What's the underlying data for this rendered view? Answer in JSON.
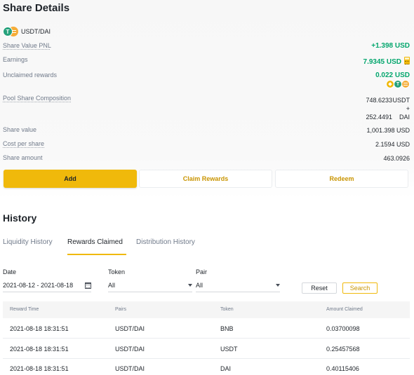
{
  "share_details": {
    "title": "Share Details",
    "pair": "USDT/DAI",
    "rows": {
      "share_value_pnl": {
        "label": "Share Value PNL",
        "value": "+1.398 USD"
      },
      "earnings": {
        "label": "Earnings",
        "value": "7.9345 USD"
      },
      "unclaimed": {
        "label": "Unclaimed rewards",
        "value": "0.022 USD"
      },
      "composition": {
        "label": "Pool Share Composition",
        "amount1": "748.6233",
        "unit1": "USDT",
        "plus": "+",
        "amount2": "252.4491",
        "unit2": "DAI"
      },
      "share_value": {
        "label": "Share value",
        "value": "1,001.398 USD"
      },
      "cost_per_share": {
        "label": "Cost per share",
        "value": "2.1594 USD"
      },
      "share_amount": {
        "label": "Share amount",
        "value": "463.0926"
      }
    },
    "buttons": {
      "add": "Add",
      "claim": "Claim Rewards",
      "redeem": "Redeem"
    },
    "reward_icons": [
      "bnb-icon",
      "usdt-icon",
      "dai-icon"
    ],
    "colors": {
      "accent": "#f0b90b",
      "positive": "#03a66d",
      "link": "#c99400"
    }
  },
  "history": {
    "title": "History",
    "tabs": [
      "Liquidity History",
      "Rewards Claimed",
      "Distribution History"
    ],
    "active_tab": "Rewards Claimed",
    "filters": {
      "date_label": "Date",
      "date_value": "2021-08-12 - 2021-08-18",
      "token_label": "Token",
      "token_value": "All",
      "pair_label": "Pair",
      "pair_value": "All",
      "reset": "Reset",
      "search": "Search"
    },
    "table": {
      "headers": [
        "Reward Time",
        "Pairs",
        "Token",
        "Amount Claimed"
      ],
      "rows": [
        [
          "2021-08-18 18:31:51",
          "USDT/DAI",
          "BNB",
          "0.03700098"
        ],
        [
          "2021-08-18 18:31:51",
          "USDT/DAI",
          "USDT",
          "0.25457568"
        ],
        [
          "2021-08-18 18:31:51",
          "USDT/DAI",
          "DAI",
          "0.40115406"
        ]
      ]
    }
  }
}
